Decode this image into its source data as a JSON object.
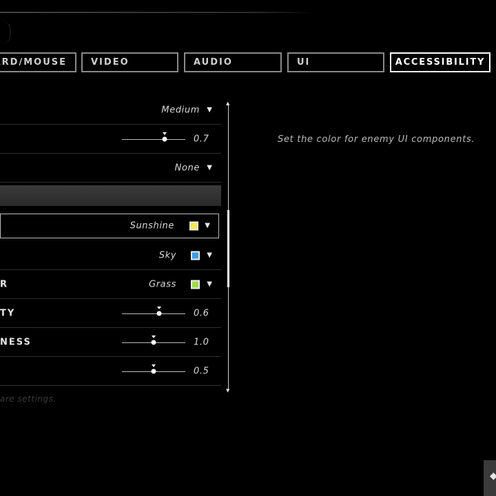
{
  "tabs": [
    {
      "label": "ARD/MOUSE",
      "active": false
    },
    {
      "label": "VIDEO",
      "active": false
    },
    {
      "label": "AUDIO",
      "active": false
    },
    {
      "label": "UI",
      "active": false
    },
    {
      "label": "ACCESSIBILITY",
      "active": true
    }
  ],
  "settings": {
    "rows": [
      {
        "label": "",
        "type": "dropdown",
        "value": "Medium"
      },
      {
        "label": "",
        "type": "slider",
        "value": "0.7",
        "fraction": 0.7
      },
      {
        "label": "",
        "type": "dropdown",
        "value": "None"
      },
      {
        "label": "",
        "type": "header"
      },
      {
        "label": "",
        "type": "color",
        "value": "Sunshine",
        "color": "#f5e94a",
        "selected": true
      },
      {
        "label": "",
        "type": "color",
        "value": "Sky",
        "color": "#3c9be8"
      },
      {
        "label": "R",
        "type": "color",
        "value": "Grass",
        "color": "#9bdc4a"
      },
      {
        "label": "TY",
        "type": "slider",
        "value": "0.6",
        "fraction": 0.6
      },
      {
        "label": "NESS",
        "type": "slider",
        "value": "1.0",
        "fraction": 0.5
      },
      {
        "label": "",
        "type": "slider",
        "value": "0.5",
        "fraction": 0.5
      }
    ]
  },
  "description": "Set the color for enemy UI components.",
  "footer_note": "are settings.",
  "icons": {
    "caret": "caret-down-icon",
    "scroll_up": "arrow-up-icon",
    "scroll_down": "arrow-down-icon",
    "corner": "logo-icon"
  },
  "colors": {
    "background": "#000000",
    "accent": "#ffffff"
  }
}
